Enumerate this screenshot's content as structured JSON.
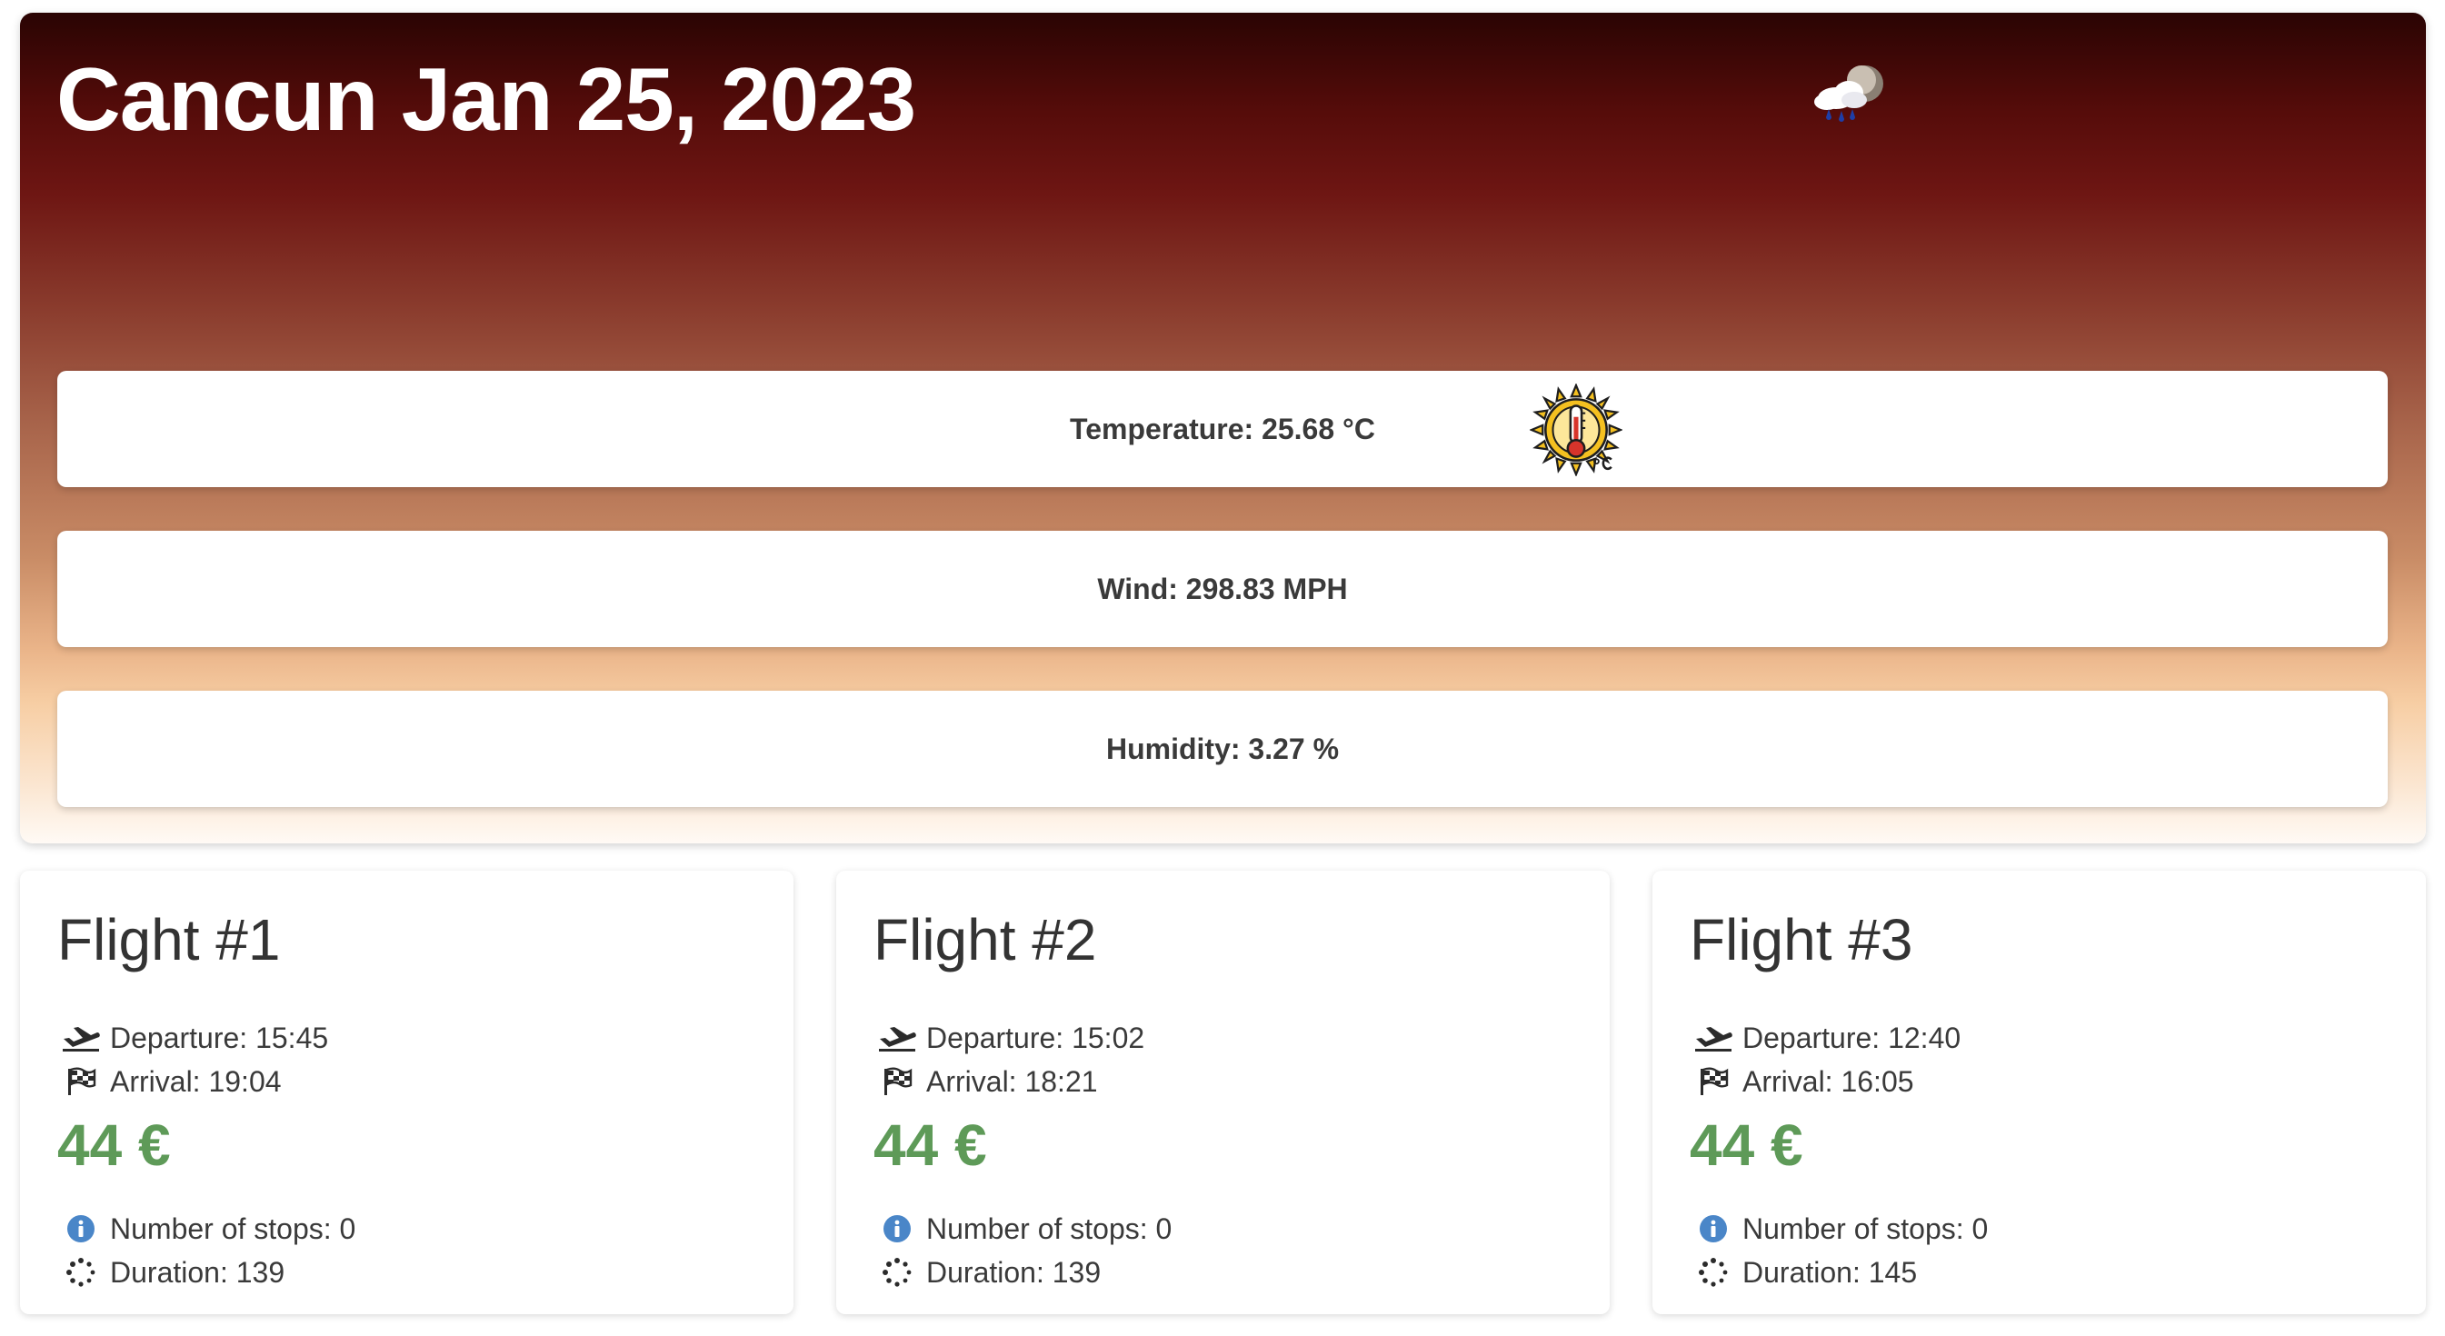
{
  "weather": {
    "city_date": "Cancun Jan 25, 2023",
    "condition_icon": "cloud-rain-moon-icon",
    "temperature": "Temperature: 25.68 °C",
    "temperature_icon": "sun-thermometer-celsius-icon",
    "wind": "Wind: 298.83 MPH",
    "humidity": "Humidity: 3.27 %"
  },
  "flights": [
    {
      "title": "Flight #1",
      "departure": "Departure: 15:45",
      "arrival": "Arrival: 19:04",
      "price": "44 €",
      "stops": "Number of stops: 0",
      "duration": "Duration: 139"
    },
    {
      "title": "Flight #2",
      "departure": "Departure: 15:02",
      "arrival": "Arrival: 18:21",
      "price": "44 €",
      "stops": "Number of stops: 0",
      "duration": "Duration: 139"
    },
    {
      "title": "Flight #3",
      "departure": "Departure: 12:40",
      "arrival": "Arrival: 16:05",
      "price": "44 €",
      "stops": "Number of stops: 0",
      "duration": "Duration: 145"
    }
  ],
  "colors": {
    "hero_top": "#2a0403",
    "hero_mid": "#6e1613",
    "hero_bottom": "#fbe6d1",
    "price": "#5e9a58",
    "info_icon": "#4a86c8"
  },
  "icons": {
    "departure": "plane-departure-icon",
    "arrival": "checkered-flag-icon",
    "stops": "info-circle-icon",
    "duration": "spinner-dots-icon"
  }
}
